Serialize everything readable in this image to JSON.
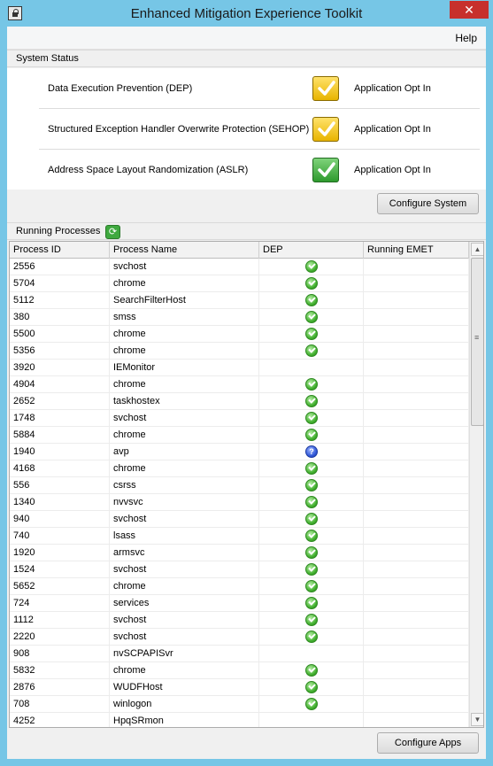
{
  "window": {
    "title": "Enhanced Mitigation Experience Toolkit",
    "close_glyph": "✕"
  },
  "menu": {
    "help": "Help"
  },
  "system_status": {
    "header": "System Status",
    "rows": [
      {
        "label": "Data Execution Prevention (DEP)",
        "icon": "yellow-check-icon",
        "value": "Application Opt In"
      },
      {
        "label": "Structured Exception Handler Overwrite Protection (SEHOP)",
        "icon": "yellow-check-icon",
        "value": "Application Opt In"
      },
      {
        "label": "Address Space Layout Randomization (ASLR)",
        "icon": "green-check-icon",
        "value": "Application Opt In"
      }
    ],
    "configure_button": "Configure System"
  },
  "processes": {
    "header": "Running Processes",
    "columns": [
      "Process ID",
      "Process Name",
      "DEP",
      "Running EMET"
    ],
    "rows": [
      {
        "pid": "2556",
        "name": "svchost",
        "dep": "ok"
      },
      {
        "pid": "5704",
        "name": "chrome",
        "dep": "ok"
      },
      {
        "pid": "5112",
        "name": "SearchFilterHost",
        "dep": "ok"
      },
      {
        "pid": "380",
        "name": "smss",
        "dep": "ok"
      },
      {
        "pid": "5500",
        "name": "chrome",
        "dep": "ok"
      },
      {
        "pid": "5356",
        "name": "chrome",
        "dep": "ok"
      },
      {
        "pid": "3920",
        "name": "IEMonitor",
        "dep": ""
      },
      {
        "pid": "4904",
        "name": "chrome",
        "dep": "ok"
      },
      {
        "pid": "2652",
        "name": "taskhostex",
        "dep": "ok"
      },
      {
        "pid": "1748",
        "name": "svchost",
        "dep": "ok"
      },
      {
        "pid": "5884",
        "name": "chrome",
        "dep": "ok"
      },
      {
        "pid": "1940",
        "name": "avp",
        "dep": "unknown"
      },
      {
        "pid": "4168",
        "name": "chrome",
        "dep": "ok"
      },
      {
        "pid": "556",
        "name": "csrss",
        "dep": "ok"
      },
      {
        "pid": "1340",
        "name": "nvvsvc",
        "dep": "ok"
      },
      {
        "pid": "940",
        "name": "svchost",
        "dep": "ok"
      },
      {
        "pid": "740",
        "name": "lsass",
        "dep": "ok"
      },
      {
        "pid": "1920",
        "name": "armsvc",
        "dep": "ok"
      },
      {
        "pid": "1524",
        "name": "svchost",
        "dep": "ok"
      },
      {
        "pid": "5652",
        "name": "chrome",
        "dep": "ok"
      },
      {
        "pid": "724",
        "name": "services",
        "dep": "ok"
      },
      {
        "pid": "1112",
        "name": "svchost",
        "dep": "ok"
      },
      {
        "pid": "2220",
        "name": "svchost",
        "dep": "ok"
      },
      {
        "pid": "908",
        "name": "nvSCPAPISvr",
        "dep": ""
      },
      {
        "pid": "5832",
        "name": "chrome",
        "dep": "ok"
      },
      {
        "pid": "2876",
        "name": "WUDFHost",
        "dep": "ok"
      },
      {
        "pid": "708",
        "name": "winlogon",
        "dep": "ok"
      },
      {
        "pid": "4252",
        "name": "HpqSRmon",
        "dep": ""
      }
    ],
    "configure_button": "Configure Apps"
  }
}
